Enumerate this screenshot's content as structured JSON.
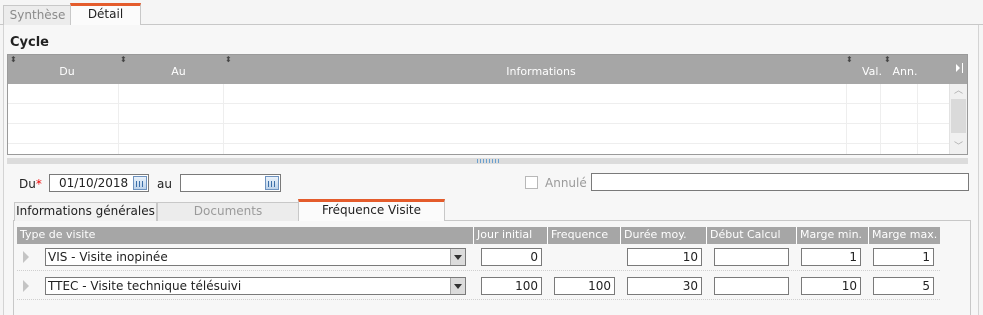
{
  "top_tabs": [
    {
      "label": "Synthèse",
      "active": false
    },
    {
      "label": "Détail",
      "active": true
    }
  ],
  "cycle": {
    "title": "Cycle",
    "columns": [
      "Du",
      "Au",
      "Informations",
      "Val.",
      "Ann."
    ],
    "rows": []
  },
  "filters": {
    "du_label": "Du",
    "required_mark": "*",
    "du_value": "01/10/2018",
    "au_label": "au",
    "au_value": "",
    "annule_label": "Annulé",
    "annule_checked": false,
    "annule_text": ""
  },
  "inner_tabs": [
    {
      "label": "Informations générales",
      "state": "normal"
    },
    {
      "label": "Documents",
      "state": "disabled"
    },
    {
      "label": "Fréquence Visite",
      "state": "active"
    }
  ],
  "frequence": {
    "columns": [
      "Type de visite",
      "Jour initial",
      "Frequence",
      "Durée moy.",
      "Début Calcul",
      "Marge min.",
      "Marge max."
    ],
    "rows": [
      {
        "type": "VIS - Visite inopinée",
        "jour_initial": "0",
        "frequence": "",
        "duree_moy": "10",
        "debut_calcul": "",
        "marge_min": "1",
        "marge_max": "1",
        "frequence_editable": false
      },
      {
        "type": "TTEC - Visite technique télésuivi",
        "jour_initial": "100",
        "frequence": "100",
        "duree_moy": "30",
        "debut_calcul": "",
        "marge_min": "10",
        "marge_max": "5",
        "frequence_editable": true
      }
    ]
  },
  "colors": {
    "accent": "#e45c2c",
    "header_gray": "#a6a6a6",
    "required": "#e00000"
  }
}
